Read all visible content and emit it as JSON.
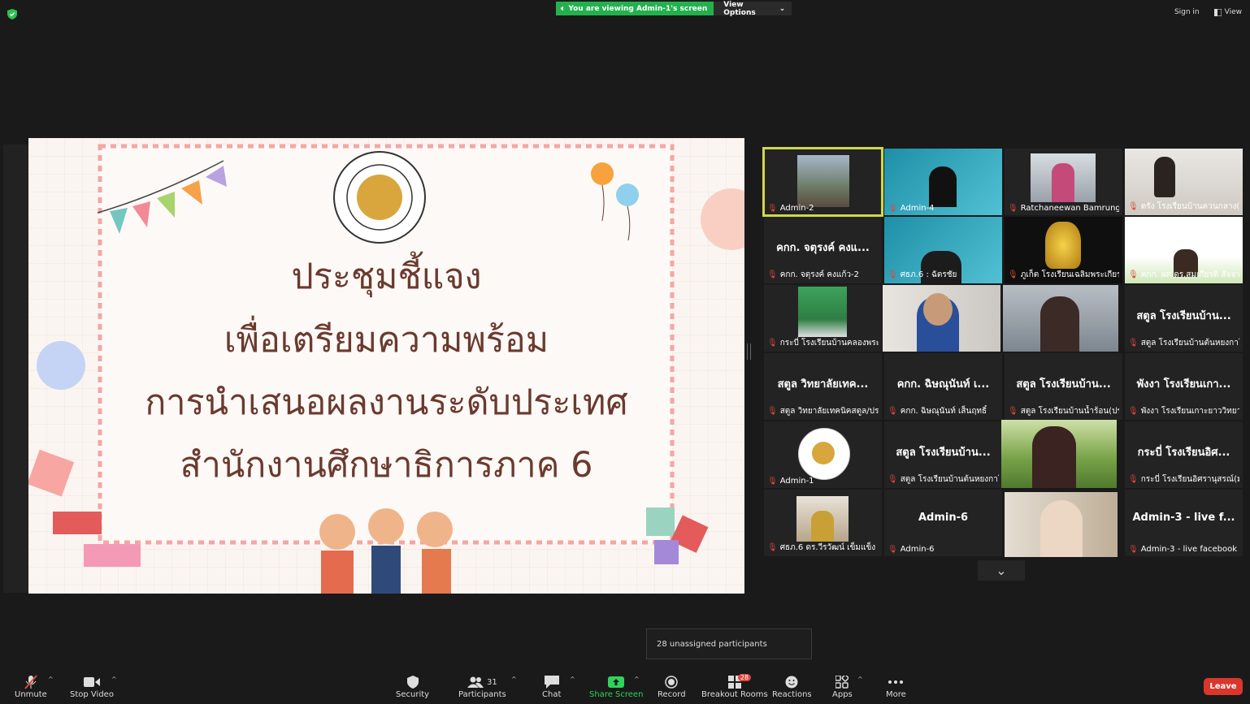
{
  "top_bar": {
    "viewing_banner": "You are viewing Admin-1's screen",
    "view_options": "View Options",
    "sign_in": "Sign in",
    "view": "View"
  },
  "slide": {
    "line1": "ประชุมชี้แจง",
    "line2": "เพื่อเตรียมความพร้อม",
    "line3": "การนำเสนอผลงานระดับประเทศ",
    "line4": "สำนักงานศึกษาธิการภาค 6"
  },
  "gallery": {
    "tiles": [
      {
        "center": "",
        "label": "Admin-2"
      },
      {
        "center": "",
        "label": "Admin-4"
      },
      {
        "center": "",
        "label": "Ratchaneewan Bamrung..."
      },
      {
        "center": "",
        "label": "ตรัง โรงเรียนบ้านควนกลาง(U..."
      },
      {
        "center": "คกก. จตุรงค์ คงแ...",
        "label": "คกก. จตุรงค์ คงแก้ว-2"
      },
      {
        "center": "",
        "label": "ศธภ.6 : ฉัตรชัย"
      },
      {
        "center": "",
        "label": "ภูเก็ต โรงเรียนเฉลิมพระเกียร..."
      },
      {
        "center": "",
        "label": "คกก. ผศ.ดร.สมเกียรติ สัจจา..."
      },
      {
        "center": "",
        "label": "กระบี่ โรงเรียนบ้านคลองพระยาวิท..."
      },
      {
        "center": "",
        "label": ""
      },
      {
        "center": "",
        "label": ""
      },
      {
        "center": "สตูล โรงเรียนบ้าน...",
        "label": "สตูล โรงเรียนบ้านต้นหยงกาโ..."
      },
      {
        "center": "สตูล วิทยาลัยเทค...",
        "label": "สตูล วิทยาลัยเทคนิคสตูล/ประ..."
      },
      {
        "center": "คกก. ฉิษณุนันท์ เ...",
        "label": "คกก. ฉิษณุนันท์ เส็นฤทธิ์"
      },
      {
        "center": "สตูล โรงเรียนบ้าน...",
        "label": "สตูล โรงเรียนบ้านน้ำร้อน(ประ..."
      },
      {
        "center": "พังงา โรงเรียนเกา...",
        "label": "พังงา โรงเรียนเกาะยาววิทยา ..."
      },
      {
        "center": "",
        "label": "Admin-1"
      },
      {
        "center": "สตูล โรงเรียนบ้าน...",
        "label": "สตูล โรงเรียนบ้านต้นหยงกาโ..."
      },
      {
        "center": "",
        "label": ""
      },
      {
        "center": "กระบี่ โรงเรียนอิศ...",
        "label": "กระบี่ โรงเรียนอิศรานุสรณ์(ม..."
      },
      {
        "center": "",
        "label": "ศธภ.6 ดร.วีรวัฒน์ เข็มแข็ง"
      },
      {
        "center": "Admin-6",
        "label": "Admin-6"
      },
      {
        "center": "",
        "label": ""
      },
      {
        "center": "Admin-3 - live f...",
        "label": "Admin-3 - live facebook"
      }
    ]
  },
  "tooltip": "28 unassigned participants",
  "toolbar": {
    "unmute": "Unmute",
    "stop_video": "Stop Video",
    "security": "Security",
    "participants": "Participants",
    "participants_count": "31",
    "chat": "Chat",
    "share_screen": "Share Screen",
    "record": "Record",
    "breakout_rooms": "Breakout Rooms",
    "breakout_badge": "28",
    "reactions": "Reactions",
    "apps": "Apps",
    "more": "More",
    "leave": "Leave"
  },
  "colors": {
    "banner_green": "#23b14d",
    "active_speaker": "#cfd848",
    "leave_red": "#d9362c",
    "slide_title": "#6b3a2e"
  }
}
